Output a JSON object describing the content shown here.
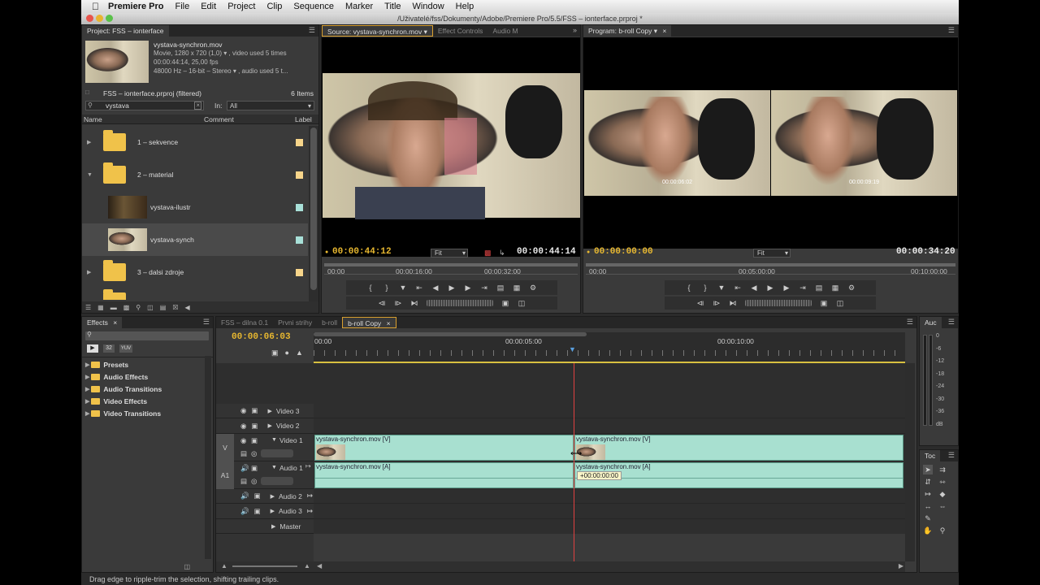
{
  "menubar": {
    "app_name": "Premiere Pro",
    "items": [
      "File",
      "Edit",
      "Project",
      "Clip",
      "Sequence",
      "Marker",
      "Title",
      "Window",
      "Help"
    ]
  },
  "window_title": "/Uživatelé/fss/Dokumenty/Adobe/Premiere Pro/5.5/FSS – ionterface.prproj *",
  "project_panel": {
    "tab": "Project: FSS – ionterface",
    "clip_name": "vystava-synchron.mov",
    "clip_info_1": "Movie, 1280 x 720 (1,0) ▾ , video used 5 times",
    "clip_info_2": "00:00:44:14, 25,00 fps",
    "clip_info_3": "48000 Hz – 16-bit – Stereo ▾ , audio used 5 t...",
    "project_name": "FSS – ionterface.prproj (filtered)",
    "item_count": "6 Items",
    "search_value": "vystava",
    "in_label": "In:",
    "in_value": "All",
    "columns": [
      "Name",
      "Comment",
      "Label"
    ],
    "rows": [
      {
        "name": "1 – sekvence",
        "type": "folder",
        "expander": "▶",
        "color": "#f7d58a"
      },
      {
        "name": "2 – material",
        "type": "folder",
        "expander": "▼",
        "color": "#f7d58a"
      },
      {
        "name": "vystava-ilustr",
        "type": "clip",
        "expander": "",
        "color": "#a8e0d8"
      },
      {
        "name": "vystava-synch",
        "type": "clip",
        "expander": "",
        "color": "#a8e0d8"
      },
      {
        "name": "3 – dalsi zdroje",
        "type": "folder",
        "expander": "▶",
        "color": "#f7d58a"
      }
    ]
  },
  "source_monitor": {
    "tabs": [
      "Source: vystava-synchron.mov ▾",
      "Effect Controls",
      "Audio M"
    ],
    "timecode_in": "00:00:44:12",
    "fit": "Fit",
    "timecode_dur": "00:00:44:14",
    "ruler_labels": [
      "00:00",
      "00:00:16:00",
      "00:00:32:00"
    ]
  },
  "program_monitor": {
    "tab": "Program: b-roll Copy ▾",
    "timecode_in": "00:00:00:00",
    "fit": "Fit",
    "timecode_dur": "00:00:34:20",
    "overlay_left": "00:00:06:02",
    "overlay_right": "00:00:09:19",
    "ruler_labels": [
      "00:00",
      "00:05:00:00",
      "00:10:00:00"
    ]
  },
  "effects_panel": {
    "tab": "Effects",
    "badges": [
      "32",
      "YUV"
    ],
    "items": [
      "Presets",
      "Audio Effects",
      "Audio Transitions",
      "Video Effects",
      "Video Transitions"
    ]
  },
  "timeline": {
    "tabs": [
      "FSS – dilna 0.1",
      "Prvni strihy",
      "b-roll",
      "b-roll Copy"
    ],
    "timecode": "00:00:06:03",
    "ruler_labels": [
      "00:00",
      "00:00:05:00",
      "00:00:10:00"
    ],
    "tracks": [
      {
        "name": "Video 3",
        "side": ""
      },
      {
        "name": "Video 2",
        "side": ""
      },
      {
        "name": "Video 1",
        "side": "V"
      },
      {
        "name": "Audio 1",
        "side": "A1"
      },
      {
        "name": "Audio 2",
        "side": ""
      },
      {
        "name": "Audio 3",
        "side": ""
      },
      {
        "name": "Master",
        "side": ""
      }
    ],
    "clip_v1_a": "vystava-synchron.mov [V]",
    "clip_v1_b": "vystava-synchron.mov [V]",
    "clip_a1_a": "vystava-synchron.mov [A]",
    "clip_a1_b": "vystava-synchron.mov [A]",
    "trim_tooltip": "+00:00:00:00"
  },
  "audio_meter": {
    "tab": "Auc",
    "scale": [
      "0",
      "-6",
      "-12",
      "-18",
      "-24",
      "-30",
      "-36",
      "dB"
    ]
  },
  "tools_panel": {
    "tab": "Toc"
  },
  "status_text": "Drag edge to ripple-trim the selection, shifting trailing clips."
}
